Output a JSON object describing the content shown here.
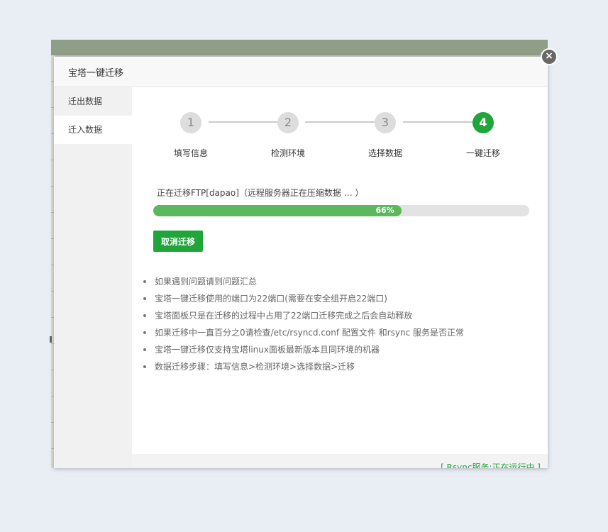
{
  "dialog": {
    "title": "宝塔一键迁移",
    "close_symbol": "×"
  },
  "sidebar": {
    "items": [
      {
        "label": "迁出数据",
        "active": false
      },
      {
        "label": "迁入数据",
        "active": true
      }
    ]
  },
  "steps": [
    {
      "number": "1",
      "label": "填写信息"
    },
    {
      "number": "2",
      "label": "检测环境"
    },
    {
      "number": "3",
      "label": "选择数据"
    },
    {
      "number": "4",
      "label": "一键迁移",
      "current": true
    }
  ],
  "progress": {
    "text": "正在迁移FTP[dapao]（远程服务器正在压缩数据 … ）",
    "percent": 66,
    "percent_label": "66%"
  },
  "cancel_button": {
    "label": "取消迁移"
  },
  "tips": [
    "如果遇到问题请到问题汇总",
    "宝塔一键迁移使用的端口为22端口(需要在安全组开启22端口)",
    "宝塔面板只是在迁移的过程中占用了22端口迁移完成之后会自动释放",
    "如果迁移中一直百分之0请检查/etc/rsyncd.conf 配置文件 和rsync 服务是否正常",
    "宝塔一键迁移仅支持宝塔linux面板最新版本且同环境的机器",
    "数据迁移步骤：填写信息>检测环境>选择数据>迁移"
  ],
  "footer": {
    "status": "[ Rsync服务:正在运行中 ]"
  },
  "colors": {
    "accent": "#20a53a",
    "progress_fill": "#5cb85c"
  }
}
